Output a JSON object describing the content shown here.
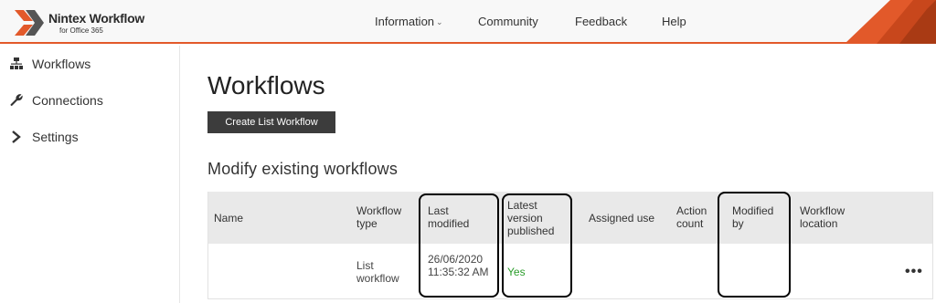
{
  "brand": {
    "title": "Nintex Workflow",
    "subtitle": "for Office 365",
    "accent_color": "#e2592a",
    "icon": "nintex-logo-icon"
  },
  "nav": {
    "items": [
      {
        "label": "Information",
        "has_dropdown": true
      },
      {
        "label": "Community"
      },
      {
        "label": "Feedback"
      },
      {
        "label": "Help"
      }
    ]
  },
  "sidebar": {
    "items": [
      {
        "label": "Workflows",
        "icon": "sitemap-icon"
      },
      {
        "label": "Connections",
        "icon": "wrench-icon"
      },
      {
        "label": "Settings",
        "icon": "chevron-right-icon"
      }
    ]
  },
  "main": {
    "title": "Workflows",
    "create_button": "Create List Workflow",
    "section_title": "Modify existing workflows"
  },
  "table": {
    "columns": [
      {
        "key": "name",
        "label": "Name"
      },
      {
        "key": "type",
        "label": "Workflow type"
      },
      {
        "key": "last_modified",
        "label": "Last modified"
      },
      {
        "key": "published",
        "label": "Latest version published"
      },
      {
        "key": "assigned",
        "label": "Assigned use"
      },
      {
        "key": "action_count",
        "label": "Action count"
      },
      {
        "key": "modified_by",
        "label": "Modified by"
      },
      {
        "key": "location",
        "label": "Workflow location"
      }
    ],
    "rows": [
      {
        "name": "",
        "type": "List workflow",
        "last_modified": "26/06/2020 11:35:32 AM",
        "published": "Yes",
        "assigned": "",
        "action_count": "",
        "modified_by": "",
        "location": "",
        "menu": "•••"
      }
    ],
    "published_color": "#2a9d2a"
  }
}
